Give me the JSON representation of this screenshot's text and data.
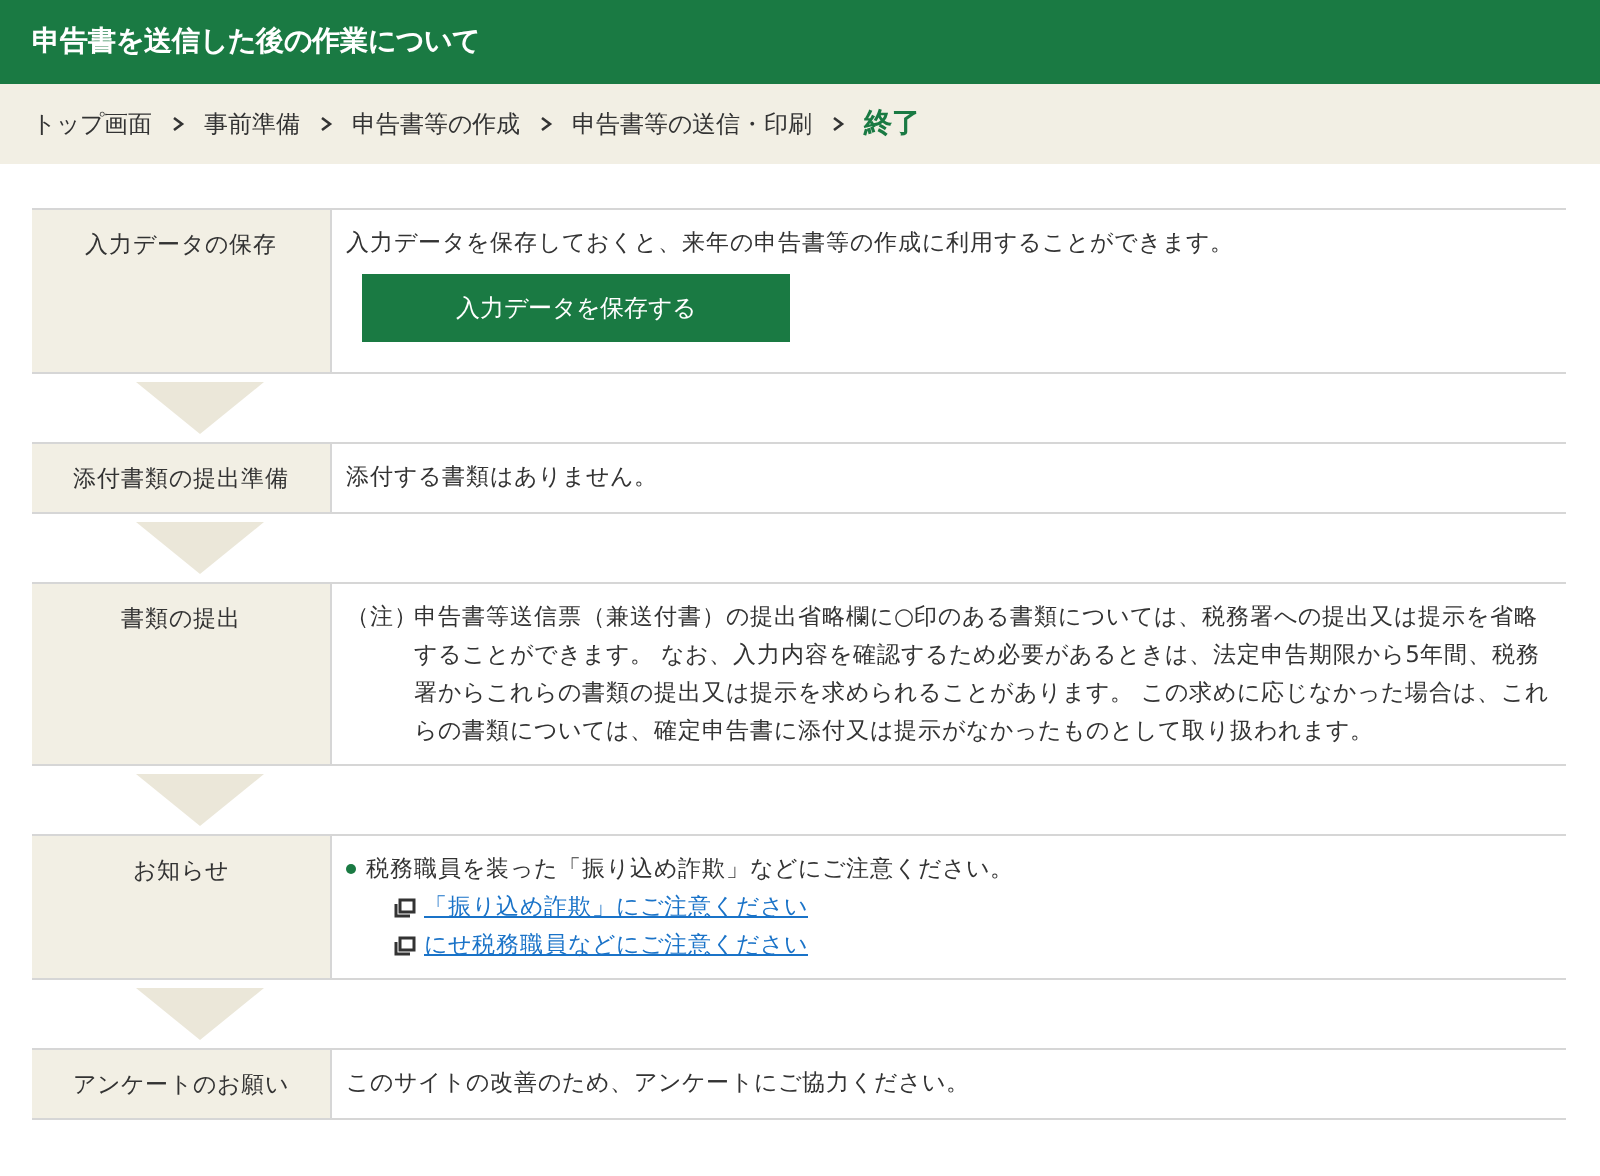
{
  "header": {
    "title": "申告書を送信した後の作業について"
  },
  "breadcrumb": [
    {
      "label": "トップ画面",
      "selected": false
    },
    {
      "label": "事前準備",
      "selected": false
    },
    {
      "label": "申告書等の作成",
      "selected": false
    },
    {
      "label": "申告書等の送信・印刷",
      "selected": false
    },
    {
      "label": "終了",
      "selected": true
    }
  ],
  "sections": [
    {
      "kind": "button",
      "label": "入力データの保存",
      "text": "入力データを保存しておくと、来年の申告書等の作成に利用することができます。",
      "button": "入力データを保存する"
    },
    {
      "kind": "text",
      "label": "添付書類の提出準備",
      "text": "添付する書類はありません。"
    },
    {
      "kind": "note",
      "label": "書類の提出",
      "marker": "（注）",
      "text": "申告書等送信票（兼送付書）の提出省略欄に○印のある書類については、税務署への提出又は提示を省略することができます。 なお、入力内容を確認するため必要があるときは、法定申告期限から5年間、税務署からこれらの書類の提出又は提示を求められることがあります。 この求めに応じなかった場合は、これらの書類については、確定申告書に添付又は提示がなかったものとして取り扱われます。"
    },
    {
      "kind": "notice",
      "label": "お知らせ",
      "text": "税務職員を装った「振り込め詐欺」などにご注意ください。",
      "links": [
        "「振り込め詐欺」にご注意ください",
        "にせ税務職員などにご注意ください"
      ]
    },
    {
      "kind": "text",
      "label": "アンケートのお願い",
      "text": "このサイトの改善のため、アンケートにご協力ください。"
    }
  ]
}
